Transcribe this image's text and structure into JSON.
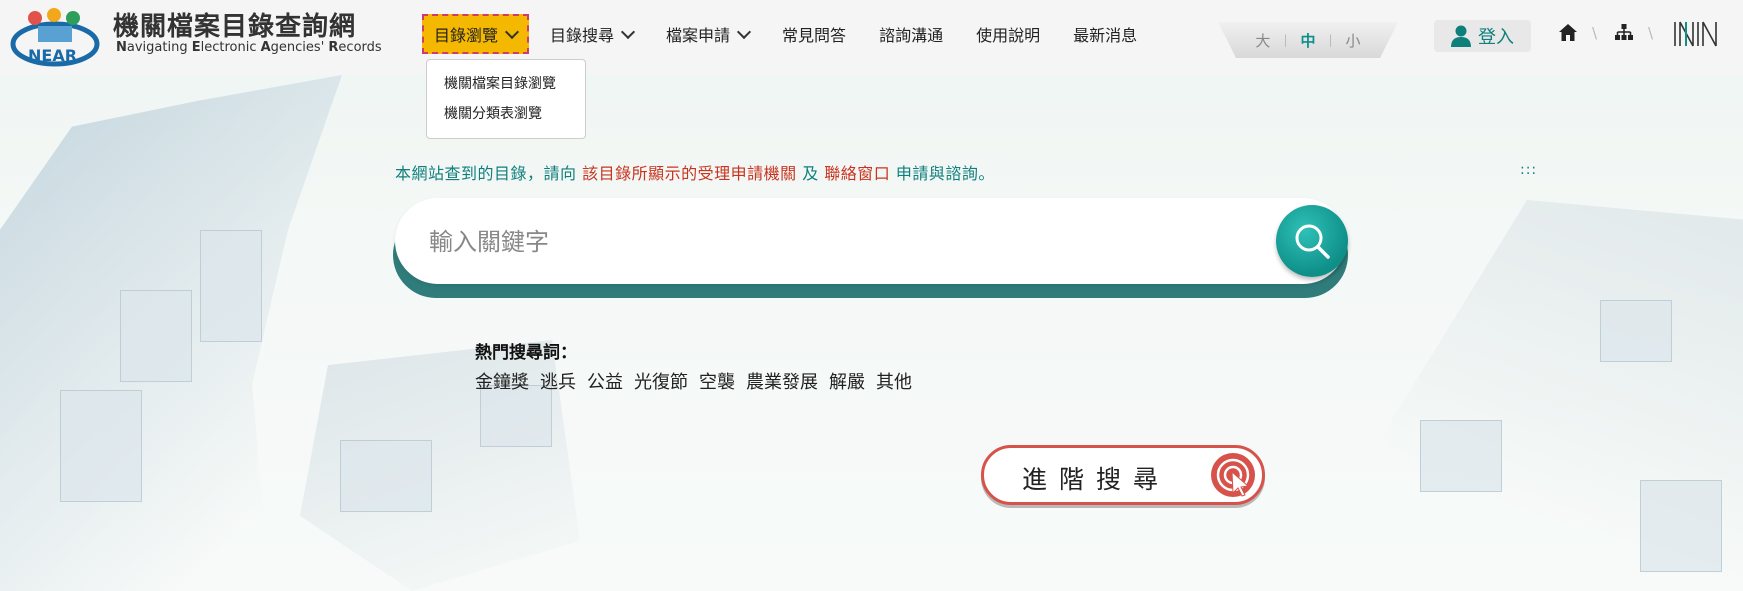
{
  "header": {
    "site_title": "機關檔案目錄查詢網",
    "site_subtitle_parts": [
      "N",
      "avigating ",
      "E",
      "lectronic ",
      "A",
      "gencies' ",
      "R",
      "ecords"
    ],
    "logo_text": "NEAR",
    "nav": [
      {
        "label": "目錄瀏覽",
        "has_dropdown": true,
        "active": true
      },
      {
        "label": "目錄搜尋",
        "has_dropdown": true,
        "active": false
      },
      {
        "label": "檔案申請",
        "has_dropdown": true,
        "active": false
      },
      {
        "label": "常見問答",
        "has_dropdown": false,
        "active": false
      },
      {
        "label": "諮詢溝通",
        "has_dropdown": false,
        "active": false
      },
      {
        "label": "使用說明",
        "has_dropdown": false,
        "active": false
      },
      {
        "label": "最新消息",
        "has_dropdown": false,
        "active": false
      }
    ],
    "dropdown": [
      "機關檔案目錄瀏覽",
      "機關分類表瀏覽"
    ],
    "font_sizes": {
      "large": "大",
      "medium": "中",
      "small": "小",
      "selected": "中"
    },
    "login_label": "登入",
    "icons": [
      "home-icon",
      "sitemap-icon",
      "nia-logo-icon"
    ]
  },
  "main": {
    "notice": {
      "part1": "本網站查到的目錄，請向 ",
      "part2": "該目錄所顯示的受理申請機關",
      "part3": " 及 ",
      "part4": "聯絡窗口",
      "part5": " 申請與諮詢。"
    },
    "accesskey": ":::",
    "search_placeholder": "輸入關鍵字",
    "hot_title": "熱門搜尋詞：",
    "hot_terms": [
      "金鐘獎",
      "逃兵",
      "公益",
      "光復節",
      "空襲",
      "農業發展",
      "解嚴",
      "其他"
    ],
    "advanced_search_label": "進階搜尋"
  },
  "colors": {
    "accent": "#0f8f8a",
    "active_nav": "#f5b800",
    "highlight_red": "#c9341f",
    "advanced_border": "#d6524a"
  }
}
